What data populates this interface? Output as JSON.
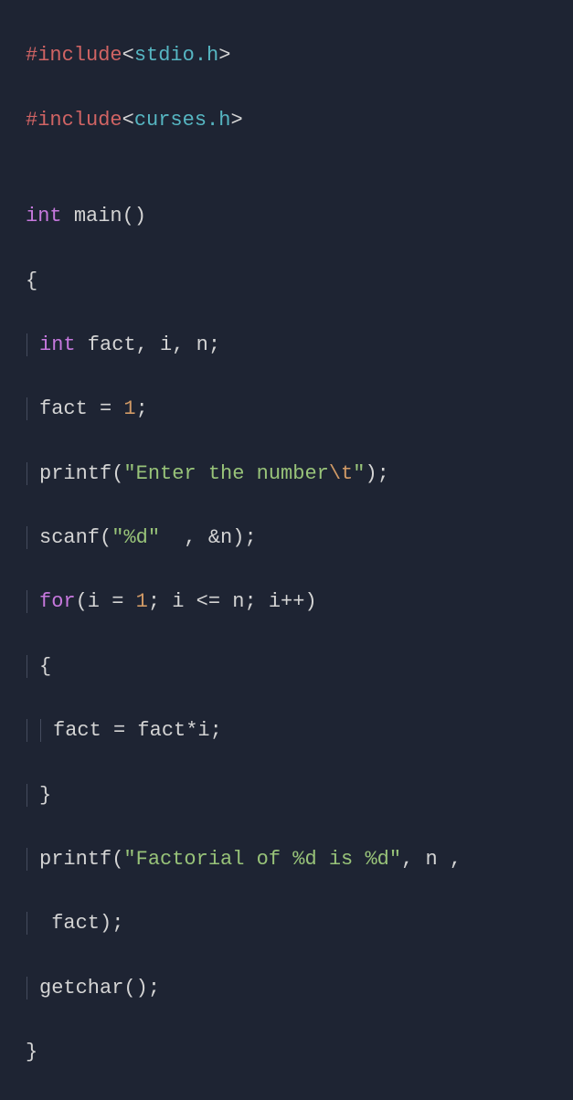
{
  "code": {
    "line1": {
      "directive": "#include",
      "open": "<",
      "header": "stdio.h",
      "close": ">"
    },
    "line2": {
      "directive": "#include",
      "open": "<",
      "header": "curses.h",
      "close": ">"
    },
    "blank": "",
    "line3": {
      "type": "int",
      "sp": " ",
      "fn": "main",
      "parens": "()"
    },
    "line4": {
      "brace": "{"
    },
    "line5": {
      "type": "int",
      "rest": " fact, i, n;"
    },
    "line6": {
      "text1": "fact = ",
      "num": "1",
      "text2": ";"
    },
    "line7": {
      "fn": "printf(",
      "str1": "\"Enter the number",
      "esc": "\\t",
      "str2": "\"",
      "end": ");"
    },
    "line8": {
      "fn": "scanf(",
      "str": "\"%d\"",
      "rest": "  , &n);"
    },
    "line9": {
      "kw": "for",
      "p1": "(i = ",
      "n1": "1",
      "p2": "; i <= n; i++)"
    },
    "line10": {
      "brace": "{"
    },
    "line11": {
      "text": "fact = fact*i;"
    },
    "line12": {
      "brace": "}"
    },
    "line13": {
      "fn": "printf(",
      "str": "\"Factorial of %d is %d\"",
      "rest": ", n ,"
    },
    "line14": {
      "text": " fact);"
    },
    "line15": {
      "text": "getchar();"
    },
    "line16": {
      "brace": "}"
    }
  }
}
